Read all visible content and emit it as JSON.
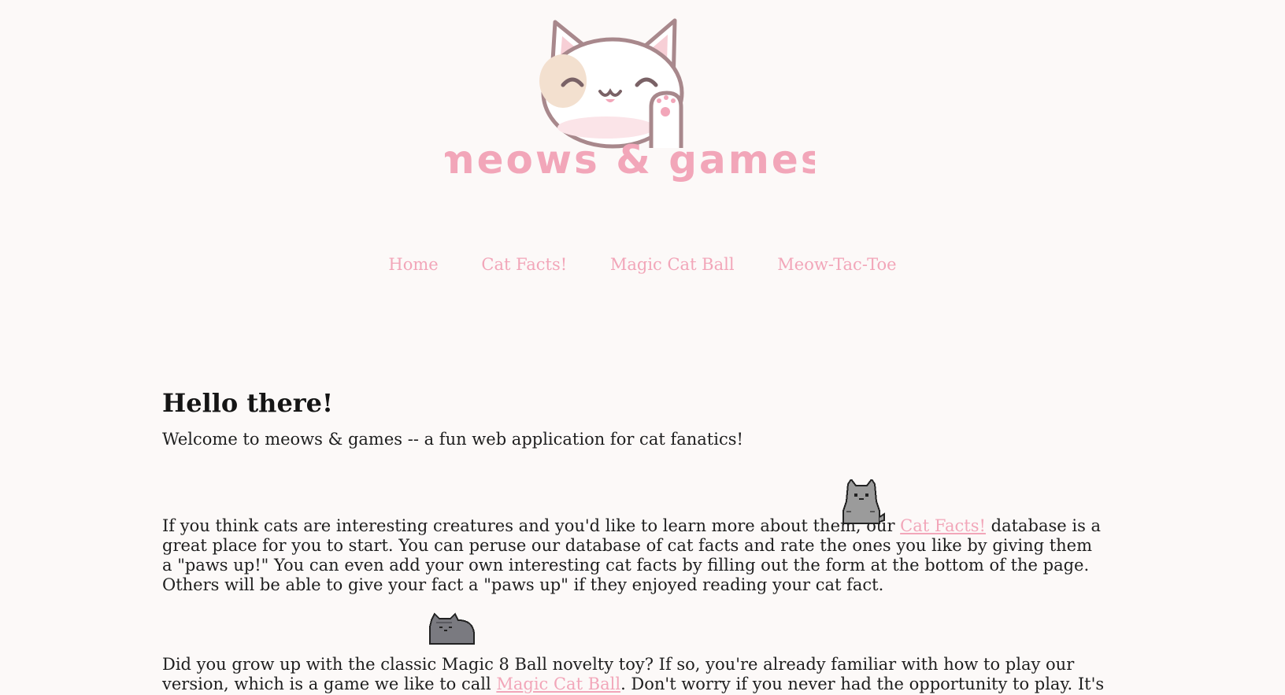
{
  "logo": {
    "text": "meows & games"
  },
  "nav": {
    "items": [
      {
        "label": "Home"
      },
      {
        "label": "Cat Facts!"
      },
      {
        "label": "Magic Cat Ball"
      },
      {
        "label": "Meow-Tac-Toe"
      }
    ]
  },
  "main": {
    "heading": "Hello there!",
    "intro": "Welcome to meows & games -- a fun web application for cat fanatics!",
    "section1": {
      "before_link": "If you think cats are interesting creatures and you'd like to learn more about them, our ",
      "link": "Cat Facts!",
      "after_link": " database is a great place for you to start. You can peruse our database of cat facts and rate the ones you like by giving them a \"paws up!\" You can even add your own interesting cat facts by filling out the form at the bottom of the page. Others will be able to give your fact a \"paws up\" if they enjoyed reading your cat fact."
    },
    "section2": {
      "before_link": "Did you grow up with the classic Magic 8 Ball novelty toy? If so, you're already familiar with how to play our version, which is a game we like to call ",
      "link": "Magic Cat Ball",
      "after_link": ". Don't worry if you never had the opportunity to play. It's easy! All you do is"
    }
  },
  "colors": {
    "background": "#fcf9f8",
    "accent_pink": "#f2a6b9",
    "text": "#1e1e1e"
  }
}
